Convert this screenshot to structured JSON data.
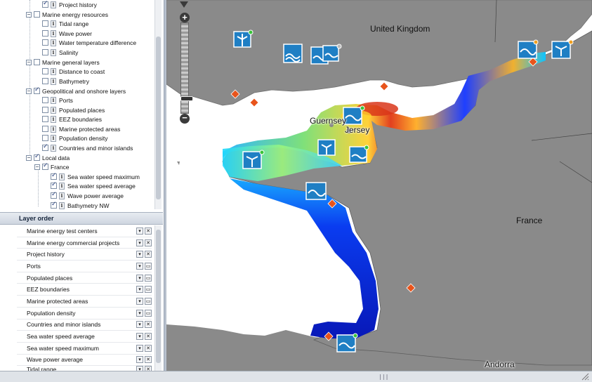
{
  "layer_tree": {
    "rows": [
      {
        "label": "Project history",
        "checked": true
      },
      {
        "label": "Marine energy resources",
        "checked": false
      },
      {
        "label": "Tidal range",
        "checked": false
      },
      {
        "label": "Wave power",
        "checked": false
      },
      {
        "label": "Water temperature difference",
        "checked": false
      },
      {
        "label": "Salinity",
        "checked": false
      },
      {
        "label": "Marine general layers",
        "checked": false
      },
      {
        "label": "Distance to coast",
        "checked": false
      },
      {
        "label": "Bathymetry",
        "checked": false
      },
      {
        "label": "Geopolitical and onshore layers",
        "checked": true
      },
      {
        "label": "Ports",
        "checked": false
      },
      {
        "label": "Populated places",
        "checked": false
      },
      {
        "label": "EEZ boundaries",
        "checked": false
      },
      {
        "label": "Marine protected areas",
        "checked": false
      },
      {
        "label": "Population density",
        "checked": false
      },
      {
        "label": "Countries and minor islands",
        "checked": true
      },
      {
        "label": "Local data",
        "checked": true
      },
      {
        "label": "France",
        "checked": true
      },
      {
        "label": "Sea water speed maximum",
        "checked": true
      },
      {
        "label": "Sea water speed average",
        "checked": true
      },
      {
        "label": "Wave power average",
        "checked": true
      },
      {
        "label": "Bathymetry NW",
        "checked": true
      }
    ]
  },
  "layer_order": {
    "title": "Layer order",
    "items": [
      {
        "label": "Marine energy test centers",
        "action": "remove"
      },
      {
        "label": "Marine energy commercial projects",
        "action": "remove"
      },
      {
        "label": "Project history",
        "action": "remove"
      },
      {
        "label": "Ports",
        "action": "window"
      },
      {
        "label": "Populated places",
        "action": "window"
      },
      {
        "label": "EEZ boundaries",
        "action": "window"
      },
      {
        "label": "Marine protected areas",
        "action": "window"
      },
      {
        "label": "Population density",
        "action": "window"
      },
      {
        "label": "Countries and minor islands",
        "action": "remove"
      },
      {
        "label": "Sea water speed average",
        "action": "remove"
      },
      {
        "label": "Sea water speed maximum",
        "action": "remove"
      },
      {
        "label": "Wave power average",
        "action": "remove"
      },
      {
        "label": "Tidal range",
        "action": "remove"
      }
    ]
  },
  "map": {
    "labels": {
      "united_kingdom": "United Kingdom",
      "guernsey": "Guernsey",
      "jersey": "Jersey",
      "france": "France",
      "andorra": "Andorra"
    },
    "colors": {
      "land": "#8a8a8a",
      "sea": "#ffffff",
      "marker_diamond": "#e8541c",
      "project_icon": "#1f7fc4"
    }
  },
  "zoom": {
    "in": "+",
    "out": "−"
  },
  "status_bar": {
    "grip": "|||"
  }
}
